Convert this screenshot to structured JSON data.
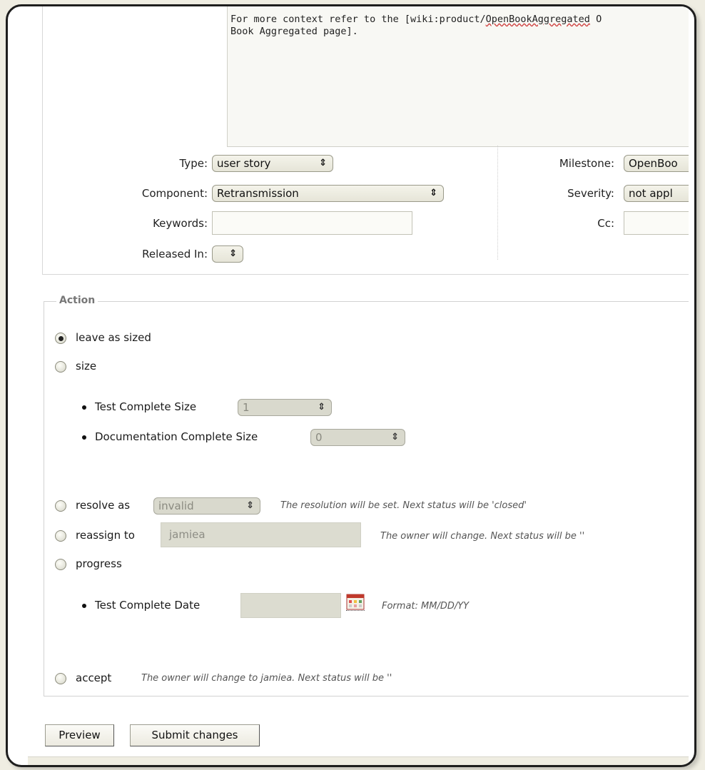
{
  "description": {
    "line1_prefix": "For more context refer to the [wiki:product/",
    "line1_link": "OpenBookAggregated",
    "line1_suffix": " O",
    "line2": "Book Aggregated page]."
  },
  "fields": {
    "type": {
      "label": "Type:",
      "value": "user story"
    },
    "component": {
      "label": "Component:",
      "value": "Retransmission"
    },
    "keywords": {
      "label": "Keywords:",
      "value": ""
    },
    "released_in": {
      "label": "Released In:",
      "value": ""
    },
    "milestone": {
      "label": "Milestone:",
      "value": "OpenBoo"
    },
    "severity": {
      "label": "Severity:",
      "value": "not appl"
    },
    "cc": {
      "label": "Cc:",
      "value": ""
    }
  },
  "action": {
    "legend": "Action",
    "leave": {
      "label": "leave as sized",
      "checked": true
    },
    "size": {
      "label": "size",
      "test_size_label": "Test Complete Size",
      "test_size_value": "1",
      "doc_size_label": "Documentation Complete Size",
      "doc_size_value": "0"
    },
    "resolve": {
      "label": "resolve as",
      "value": "invalid",
      "hint": "The resolution will be set. Next status will be 'closed'"
    },
    "reassign": {
      "label": "reassign to",
      "value": "jamiea",
      "hint": "The owner will change. Next status will be ''"
    },
    "progress": {
      "label": "progress",
      "date_label": "Test Complete Date",
      "date_value": "",
      "format_hint": "Format: MM/DD/YY"
    },
    "accept": {
      "label": "accept",
      "hint": "The owner will change to jamiea. Next status will be ''"
    }
  },
  "buttons": {
    "preview": "Preview",
    "submit": "Submit changes"
  },
  "colors": {
    "page_bg": "#efede2",
    "frame": "#1e1e1e",
    "disabled_field": "#dcdcd0"
  }
}
